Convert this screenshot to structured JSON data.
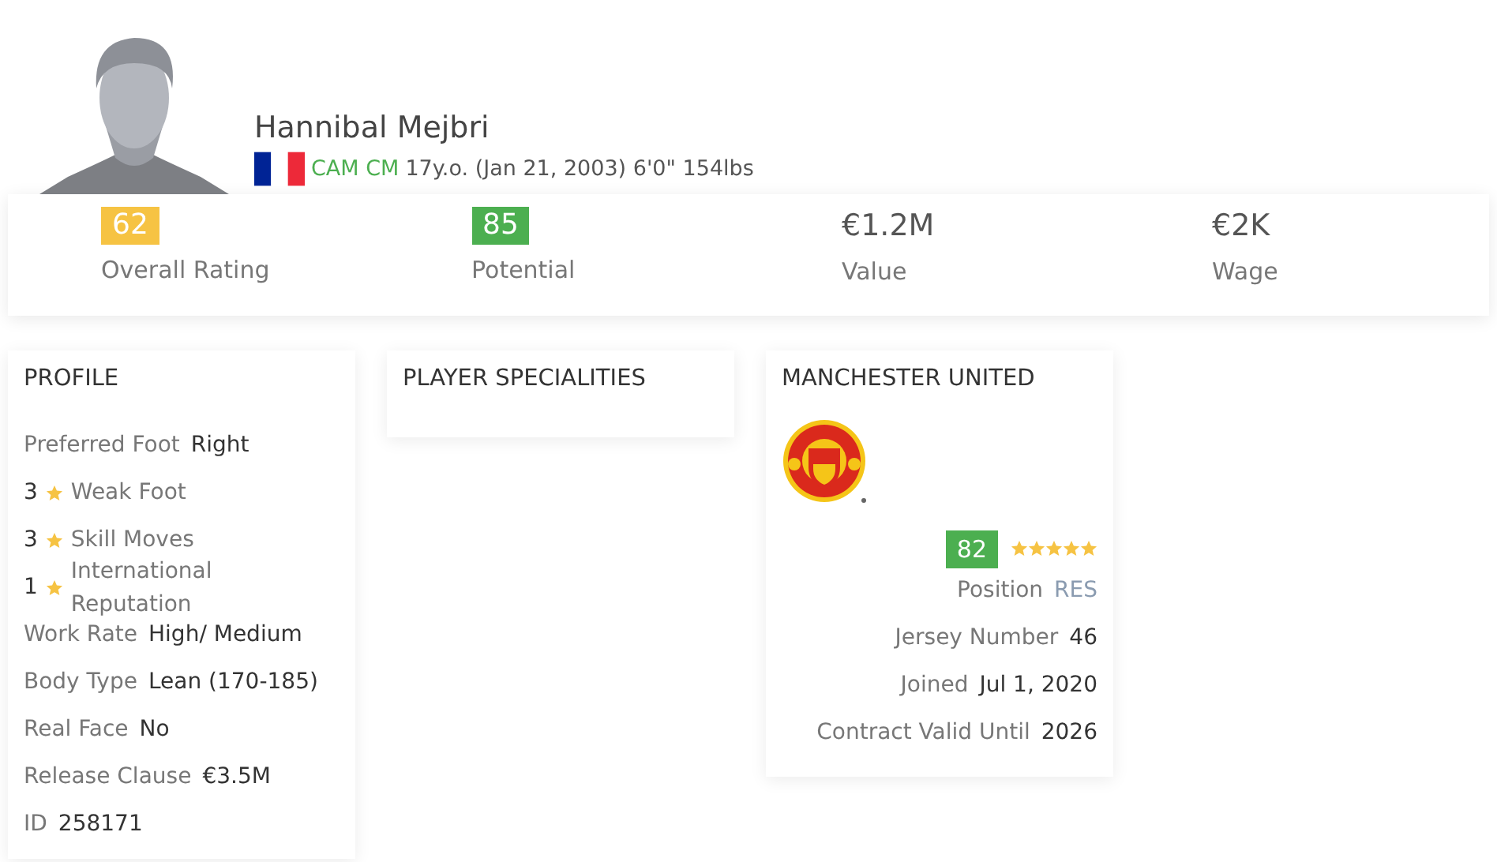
{
  "player": {
    "name": "Hannibal Mejbri",
    "positions": "CAM CM",
    "info": "17y.o. (Jan 21, 2003) 6'0\" 154lbs"
  },
  "stats": [
    {
      "kind": "badge",
      "value": "62",
      "label": "Overall Rating",
      "color": "#f6c343"
    },
    {
      "kind": "badge",
      "value": "85",
      "label": "Potential",
      "color": "#4caf50"
    },
    {
      "kind": "plain",
      "value": "€1.2M",
      "label": "Value"
    },
    {
      "kind": "plain",
      "value": "€2K",
      "label": "Wage"
    }
  ],
  "profile": {
    "title": "PROFILE",
    "rows": [
      {
        "kind": "pair",
        "label": "Preferred Foot",
        "value": "Right"
      },
      {
        "kind": "rating",
        "value": "3",
        "label": "Weak Foot"
      },
      {
        "kind": "rating",
        "value": "3",
        "label": "Skill Moves"
      },
      {
        "kind": "rating",
        "value": "1",
        "label": "International Reputation"
      },
      {
        "kind": "pair",
        "label": "Work Rate",
        "value": "High/ Medium"
      },
      {
        "kind": "pair",
        "label": "Body Type",
        "value": "Lean (170-185)"
      },
      {
        "kind": "pair",
        "label": "Real Face",
        "value": "No"
      },
      {
        "kind": "pair",
        "label": "Release Clause",
        "value": "€3.5M"
      },
      {
        "kind": "pair",
        "label": "ID",
        "value": "258171"
      }
    ]
  },
  "specialities": {
    "title": "PLAYER SPECIALITIES"
  },
  "club": {
    "title": "MANCHESTER UNITED",
    "rating": {
      "value": "82",
      "color": "#4caf50"
    },
    "stars": 5,
    "rows": [
      {
        "kind": "link",
        "label": "Position",
        "value": "RES"
      },
      {
        "kind": "pair",
        "label": "Jersey Number",
        "value": "46"
      },
      {
        "kind": "pair",
        "label": "Joined",
        "value": "Jul 1, 2020"
      },
      {
        "kind": "pair",
        "label": "Contract Valid Until",
        "value": "2026"
      }
    ]
  }
}
